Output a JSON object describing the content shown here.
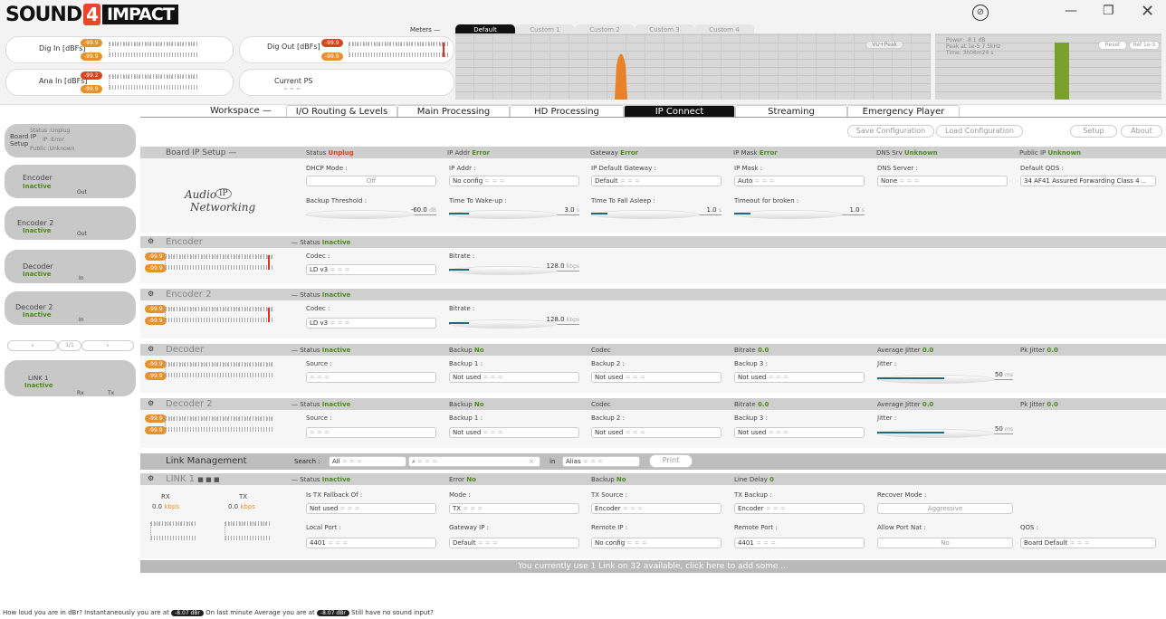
{
  "app": {
    "logo_a": "SOUND",
    "logo_b": "4",
    "logo_c": "IMPACT"
  },
  "topbar": {
    "dig_in": {
      "label": "Dig In [dBFs]",
      "v1": "-99.9",
      "v2": "-99.9"
    },
    "dig_out": {
      "label": "Dig Out [dBFs]",
      "v1": "-99.9",
      "v2": "-99.9"
    },
    "ana_in": {
      "label": "Ana In [dBFs]",
      "v1": "-99.2",
      "v2": "-99.9"
    },
    "current_ps": {
      "label": "Current PS",
      "value": "= = ="
    },
    "meters_label": "Meters —",
    "meter_tabs": [
      "Default",
      "Custom 1",
      "Custom 2",
      "Custom 3",
      "Custom 4"
    ],
    "vu_peak": "VU+Peak",
    "scope": {
      "power": "Power: -8.1 dB",
      "peak": "Peak at 1e-5 7.5kHz",
      "time": "Time: 3h06m24 s",
      "reset": "Reset",
      "ref": "Ref 1e-5"
    }
  },
  "workspace": {
    "label": "Workspace —",
    "tabs": [
      "I/O Routing & Levels",
      "Main Processing",
      "HD Processing",
      "IP Connect",
      "Streaming",
      "Emergency Player"
    ],
    "active": "IP Connect"
  },
  "sidebar": {
    "board": {
      "title": "Board IP Setup",
      "status": "Status :Unplug",
      "ip": "IP :Error",
      "public": "Public :Unknown"
    },
    "items": [
      {
        "name": "Encoder",
        "state": "Inactive",
        "io": "Out"
      },
      {
        "name": "Encoder 2",
        "state": "Inactive",
        "io": "Out"
      },
      {
        "name": "Decoder",
        "state": "Inactive",
        "io": "In"
      },
      {
        "name": "Decoder 2",
        "state": "Inactive",
        "io": "In"
      }
    ],
    "pager": {
      "prev": "‹",
      "page": "1/1",
      "next": "›"
    },
    "link": {
      "name": "LINK 1",
      "state": "Inactive",
      "rx": "Rx",
      "tx": "Tx"
    }
  },
  "toolbar": {
    "save": "Save Configuration",
    "load": "Load Configuration",
    "setup": "Setup",
    "about": "About"
  },
  "board": {
    "title": "Board IP Setup —",
    "status_label": "Status",
    "status_val": "Unplug",
    "ipaddr_label": "IP Addr",
    "ipaddr_val": "Error",
    "gw_label": "Gateway",
    "gw_val": "Error",
    "mask_label": "IP Mask",
    "mask_val": "Error",
    "dns_label": "DNS Srv",
    "dns_val": "Unknown",
    "pub_label": "Public IP",
    "pub_val": "Unknown",
    "logo_a": "Audio",
    "logo_b": "IP",
    "logo_c": "Networking",
    "dhcp_label": "DHCP Mode :",
    "dhcp_val": "Off",
    "ip_label": "IP Addr :",
    "ip_val": "No config",
    "dgw_label": "IP Default Gateway :",
    "dgw_val": "Default",
    "ipm_label": "IP Mask :",
    "ipm_val": "Auto",
    "dnss_label": "DNS Server :",
    "dnss_val": "None",
    "qos_label": "Default QOS :",
    "qos_val": "34 AF41 Assured Forwarding Class 4 ..",
    "backup_label": "Backup Threshold :",
    "backup_val": "-60.0",
    "backup_unit": "dB",
    "wake_label": "Time To Wake-up :",
    "wake_val": "3.0",
    "wake_unit": "s",
    "sleep_label": "Time To Fall Asleep :",
    "sleep_val": "1.0",
    "sleep_unit": "s",
    "broken_label": "Timeout for broken :",
    "broken_val": "1.0",
    "broken_unit": "s"
  },
  "encoders": [
    {
      "title": "Encoder",
      "status": "— Status",
      "state": "Inactive",
      "codec_label": "Codec :",
      "codec": "LD v3",
      "bitrate_label": "Bitrate :",
      "bitrate": "128.0",
      "unit": "kbps",
      "m1": "-99.9",
      "m2": "-99.9"
    },
    {
      "title": "Encoder 2",
      "status": "— Status",
      "state": "Inactive",
      "codec_label": "Codec :",
      "codec": "LD v3",
      "bitrate_label": "Bitrate :",
      "bitrate": "128.0",
      "unit": "kbps",
      "m1": "-99.9",
      "m2": "-99.9"
    }
  ],
  "decoders": [
    {
      "title": "Decoder",
      "status": "— Status",
      "state": "Inactive",
      "backup": "Backup",
      "backup_val": "No",
      "codec": "Codec",
      "bitrate": "Bitrate",
      "bitrate_val": "0.0",
      "avg": "Average Jitter",
      "avg_val": "0.0",
      "pk": "Pk Jitter",
      "pk_val": "0.0",
      "source_label": "Source :",
      "b1_label": "Backup 1 :",
      "b1": "Not used",
      "b2_label": "Backup 2 :",
      "b2": "Not used",
      "b3_label": "Backup 3 :",
      "b3": "Not used",
      "jitter_label": "Jitter :",
      "jitter": "50",
      "jitter_unit": "ms",
      "m1": "-99.9",
      "m2": "-99.9"
    },
    {
      "title": "Decoder 2",
      "status": "— Status",
      "state": "Inactive",
      "backup": "Backup",
      "backup_val": "No",
      "codec": "Codec",
      "bitrate": "Bitrate",
      "bitrate_val": "0.0",
      "avg": "Average Jitter",
      "avg_val": "0.0",
      "pk": "Pk Jitter",
      "pk_val": "0.0",
      "source_label": "Source :",
      "b1_label": "Backup 1 :",
      "b1": "Not used",
      "b2_label": "Backup 2 :",
      "b2": "Not used",
      "b3_label": "Backup 3 :",
      "b3": "Not used",
      "jitter_label": "Jitter :",
      "jitter": "50",
      "jitter_unit": "ms",
      "m1": "-99.9",
      "m2": "-99.9"
    }
  ],
  "links": {
    "title": "Link Management",
    "search_label": "Search :",
    "search_val": "All",
    "in_label": "in",
    "in_val": "Alias",
    "print": "Print",
    "link": {
      "title": "LINK 1",
      "status": "— Status",
      "state": "Inactive",
      "error": "Error",
      "error_val": "No",
      "backup": "Backup",
      "backup_val": "No",
      "delay": "Line Delay",
      "delay_val": "0",
      "rx": "RX",
      "tx": "TX",
      "rx_val": "0.0",
      "tx_val": "0.0",
      "kbps": "kbps",
      "fallback_label": "Is TX Fallback Of :",
      "fallback": "Not used",
      "mode_label": "Mode :",
      "mode": "TX",
      "txsrc_label": "TX Source :",
      "txsrc": "Encoder",
      "txbk_label": "TX Backup :",
      "txbk": "Encoder",
      "recover_label": "Recover Mode :",
      "recover": "Aggressive",
      "lport_label": "Local Port :",
      "lport": "4401",
      "gwip_label": "Gateway IP :",
      "gwip": "Default",
      "rip_label": "Remote IP :",
      "rip": "No config",
      "rport_label": "Remote Port :",
      "rport": "4401",
      "nat_label": "Allow Port Nat :",
      "nat": "No",
      "qos_label": "QOS :",
      "qos": "Board Default"
    },
    "footer": "You currently use 1 Link on 32 available, click here to add some ..."
  },
  "status": {
    "a": "How loud you are in dBr?  Instantaneously you are at",
    "v1": "-8.07 dBr",
    "b": "On last minute Average you are at",
    "v2": "-8.07 dBr",
    "c": "Still have no sound input?"
  },
  "colors": {
    "accent": "#e8912a",
    "active": "#4e8a1e",
    "error": "#d9441e",
    "slider": "#1f6b7e",
    "spectrum_peak": "#e8822a",
    "scope_bar": "#7aa12e"
  }
}
